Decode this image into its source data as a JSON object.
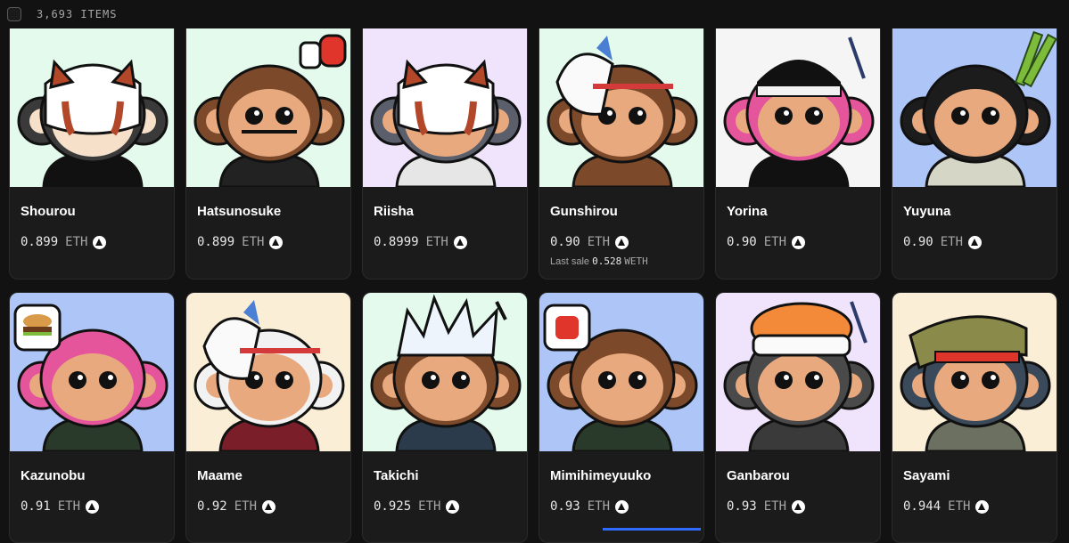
{
  "header": {
    "item_count": "3,693 ITEMS"
  },
  "cards": [
    {
      "name": "Shourou",
      "price": "0.899",
      "currency": "ETH",
      "bg": "#e3faec",
      "fur": "#3a3a3a",
      "face": "#f6e0c9",
      "mask": "redpanda",
      "shirt": "#111111"
    },
    {
      "name": "Hatsunosuke",
      "price": "0.899",
      "currency": "ETH",
      "bg": "#e3faec",
      "fur": "#7c4a2a",
      "face": "#e8a97f",
      "mask": "lantern",
      "shirt": "#222222"
    },
    {
      "name": "Riisha",
      "price": "0.8999",
      "currency": "ETH",
      "bg": "#efe4fb",
      "fur": "#5a5f6b",
      "face": "#e8a97f",
      "mask": "redpanda",
      "shirt": "#e6e6e6"
    },
    {
      "name": "Gunshirou",
      "price": "0.90",
      "currency": "ETH",
      "bg": "#e3faec",
      "fur": "#7c4a2a",
      "face": "#e8a97f",
      "mask": "fox",
      "shirt": "#7c4a2a",
      "last_sale_label": "Last sale",
      "last_sale_value": "0.528",
      "last_sale_currency": "WETH"
    },
    {
      "name": "Yorina",
      "price": "0.90",
      "currency": "ETH",
      "bg": "#f5f5f5",
      "fur": "#e5559b",
      "face": "#e8a97f",
      "mask": "helmet",
      "shirt": "#111111"
    },
    {
      "name": "Yuyuna",
      "price": "0.90",
      "currency": "ETH",
      "bg": "#aec6f7",
      "fur": "#1c1c1c",
      "face": "#e8a97f",
      "mask": "bamboo",
      "shirt": "#d6d6c6"
    },
    {
      "name": "Kazunobu",
      "price": "0.91",
      "currency": "ETH",
      "bg": "#aec6f7",
      "fur": "#e5559b",
      "face": "#e8a97f",
      "mask": "burger",
      "shirt": "#2a3a2a"
    },
    {
      "name": "Maame",
      "price": "0.92",
      "currency": "ETH",
      "bg": "#fbeed6",
      "fur": "#f2f2f2",
      "face": "#e8a97f",
      "mask": "fox",
      "shirt": "#7a1f2a"
    },
    {
      "name": "Takichi",
      "price": "0.925",
      "currency": "ETH",
      "bg": "#e3faec",
      "fur": "#7c4a2a",
      "face": "#e8a97f",
      "mask": "spiky",
      "shirt": "#2b3b4b"
    },
    {
      "name": "Mimihimeyuuko",
      "price": "0.93",
      "currency": "ETH",
      "bg": "#aec6f7",
      "fur": "#7c4a2a",
      "face": "#e8a97f",
      "mask": "angry",
      "shirt": "#2a3a2a"
    },
    {
      "name": "Ganbarou",
      "price": "0.93",
      "currency": "ETH",
      "bg": "#efe4fb",
      "fur": "#4a4a4a",
      "face": "#e8a97f",
      "mask": "sushi",
      "shirt": "#3a3a3a"
    },
    {
      "name": "Sayami",
      "price": "0.944",
      "currency": "ETH",
      "bg": "#fbeed6",
      "fur": "#3a4a5a",
      "face": "#e8a97f",
      "mask": "bandana",
      "shirt": "#6b7060"
    }
  ]
}
